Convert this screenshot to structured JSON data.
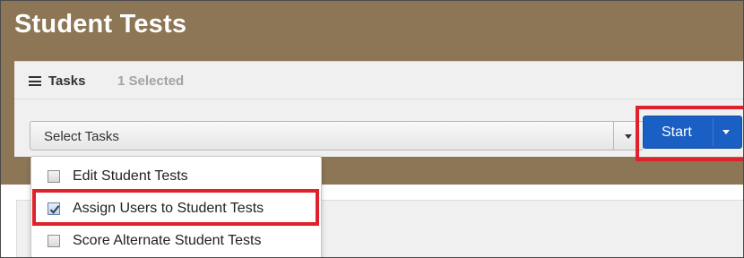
{
  "page": {
    "title": "Student Tests"
  },
  "tasks": {
    "heading": "Tasks",
    "selected_count": "1 Selected",
    "select_placeholder": "Select Tasks",
    "start_label": "Start",
    "options": [
      {
        "label": "Edit Student Tests",
        "checked": false
      },
      {
        "label": "Assign Users to Student Tests",
        "checked": true
      },
      {
        "label": "Score Alternate Student Tests",
        "checked": false
      }
    ]
  },
  "colors": {
    "header_bg": "#8c7656",
    "panel_bg": "#f0f0f0",
    "primary_button": "#1a5fc4",
    "highlight_red": "#e0202a"
  },
  "icons": {
    "tasks": "list-icon",
    "select_caret": "caret-down-icon",
    "start_caret": "caret-down-icon"
  }
}
